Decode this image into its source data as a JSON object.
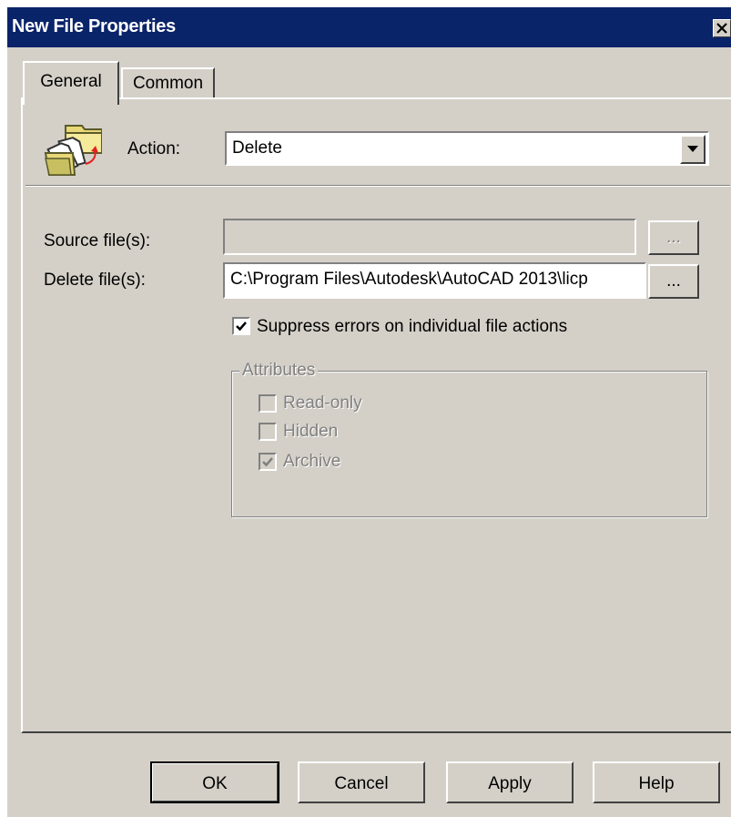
{
  "window": {
    "title": "New File Properties"
  },
  "tabs": [
    {
      "label": "General",
      "active": true
    },
    {
      "label": "Common",
      "active": false
    }
  ],
  "action": {
    "label": "Action:",
    "value": "Delete"
  },
  "source": {
    "label": "Source file(s):",
    "value": "",
    "browse_label": "...",
    "enabled": false
  },
  "delete": {
    "label": "Delete file(s):",
    "value": "C:\\Program Files\\Autodesk\\AutoCAD 2013\\licp",
    "browse_label": "..."
  },
  "suppress": {
    "label": "Suppress errors on individual file actions",
    "checked": true
  },
  "attributes": {
    "legend": "Attributes",
    "items": [
      {
        "label": "Read-only",
        "checked": false
      },
      {
        "label": "Hidden",
        "checked": false
      },
      {
        "label": "Archive",
        "checked": true
      }
    ]
  },
  "buttons": {
    "ok": "OK",
    "cancel": "Cancel",
    "apply": "Apply",
    "help": "Help"
  },
  "icons": {
    "action": "file-folder-icon",
    "close": "close-icon",
    "dropdown": "chevron-down-icon"
  }
}
